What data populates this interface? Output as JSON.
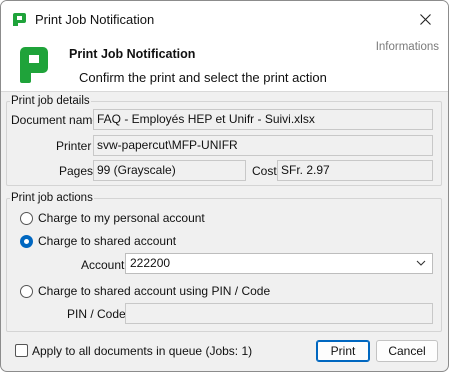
{
  "window": {
    "title": "Print Job Notification"
  },
  "header": {
    "title": "Print Job Notification",
    "subtitle": "Confirm the print and select the print action",
    "info": "Informations"
  },
  "details": {
    "legend": "Print job details",
    "document_label": "Document name",
    "document_value": "FAQ - Employés HEP et Unifr - Suivi.xlsx",
    "printer_label": "Printer",
    "printer_value": "svw-papercut\\MFP-UNIFR",
    "pages_label": "Pages",
    "pages_value": "99  (Grayscale)",
    "cost_label": "Cost",
    "cost_value": "SFr. 2.97"
  },
  "actions": {
    "legend": "Print job actions",
    "option_personal": "Charge to my personal account",
    "option_shared": "Charge to shared account",
    "account_label": "Account",
    "account_value": "222200",
    "option_pin": "Charge to shared account using PIN / Code",
    "pin_label": "PIN / Code",
    "pin_value": "",
    "selected": "shared"
  },
  "footer": {
    "apply_all_label": "Apply to all documents in queue (Jobs: 1)",
    "apply_all_checked": false,
    "print_label": "Print",
    "cancel_label": "Cancel"
  },
  "colors": {
    "brand_green": "#1fa33a",
    "accent_blue": "#0067c0"
  }
}
